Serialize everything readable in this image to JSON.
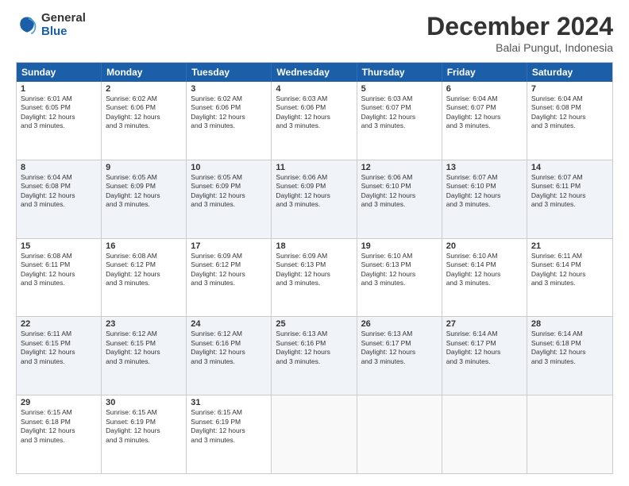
{
  "logo": {
    "line1": "General",
    "line2": "Blue"
  },
  "title": "December 2024",
  "location": "Balai Pungut, Indonesia",
  "days": [
    "Sunday",
    "Monday",
    "Tuesday",
    "Wednesday",
    "Thursday",
    "Friday",
    "Saturday"
  ],
  "rows": [
    [
      {
        "day": "1",
        "text": "Sunrise: 6:01 AM\nSunset: 6:05 PM\nDaylight: 12 hours\nand 3 minutes."
      },
      {
        "day": "2",
        "text": "Sunrise: 6:02 AM\nSunset: 6:06 PM\nDaylight: 12 hours\nand 3 minutes."
      },
      {
        "day": "3",
        "text": "Sunrise: 6:02 AM\nSunset: 6:06 PM\nDaylight: 12 hours\nand 3 minutes."
      },
      {
        "day": "4",
        "text": "Sunrise: 6:03 AM\nSunset: 6:06 PM\nDaylight: 12 hours\nand 3 minutes."
      },
      {
        "day": "5",
        "text": "Sunrise: 6:03 AM\nSunset: 6:07 PM\nDaylight: 12 hours\nand 3 minutes."
      },
      {
        "day": "6",
        "text": "Sunrise: 6:04 AM\nSunset: 6:07 PM\nDaylight: 12 hours\nand 3 minutes."
      },
      {
        "day": "7",
        "text": "Sunrise: 6:04 AM\nSunset: 6:08 PM\nDaylight: 12 hours\nand 3 minutes."
      }
    ],
    [
      {
        "day": "8",
        "text": "Sunrise: 6:04 AM\nSunset: 6:08 PM\nDaylight: 12 hours\nand 3 minutes."
      },
      {
        "day": "9",
        "text": "Sunrise: 6:05 AM\nSunset: 6:09 PM\nDaylight: 12 hours\nand 3 minutes."
      },
      {
        "day": "10",
        "text": "Sunrise: 6:05 AM\nSunset: 6:09 PM\nDaylight: 12 hours\nand 3 minutes."
      },
      {
        "day": "11",
        "text": "Sunrise: 6:06 AM\nSunset: 6:09 PM\nDaylight: 12 hours\nand 3 minutes."
      },
      {
        "day": "12",
        "text": "Sunrise: 6:06 AM\nSunset: 6:10 PM\nDaylight: 12 hours\nand 3 minutes."
      },
      {
        "day": "13",
        "text": "Sunrise: 6:07 AM\nSunset: 6:10 PM\nDaylight: 12 hours\nand 3 minutes."
      },
      {
        "day": "14",
        "text": "Sunrise: 6:07 AM\nSunset: 6:11 PM\nDaylight: 12 hours\nand 3 minutes."
      }
    ],
    [
      {
        "day": "15",
        "text": "Sunrise: 6:08 AM\nSunset: 6:11 PM\nDaylight: 12 hours\nand 3 minutes."
      },
      {
        "day": "16",
        "text": "Sunrise: 6:08 AM\nSunset: 6:12 PM\nDaylight: 12 hours\nand 3 minutes."
      },
      {
        "day": "17",
        "text": "Sunrise: 6:09 AM\nSunset: 6:12 PM\nDaylight: 12 hours\nand 3 minutes."
      },
      {
        "day": "18",
        "text": "Sunrise: 6:09 AM\nSunset: 6:13 PM\nDaylight: 12 hours\nand 3 minutes."
      },
      {
        "day": "19",
        "text": "Sunrise: 6:10 AM\nSunset: 6:13 PM\nDaylight: 12 hours\nand 3 minutes."
      },
      {
        "day": "20",
        "text": "Sunrise: 6:10 AM\nSunset: 6:14 PM\nDaylight: 12 hours\nand 3 minutes."
      },
      {
        "day": "21",
        "text": "Sunrise: 6:11 AM\nSunset: 6:14 PM\nDaylight: 12 hours\nand 3 minutes."
      }
    ],
    [
      {
        "day": "22",
        "text": "Sunrise: 6:11 AM\nSunset: 6:15 PM\nDaylight: 12 hours\nand 3 minutes."
      },
      {
        "day": "23",
        "text": "Sunrise: 6:12 AM\nSunset: 6:15 PM\nDaylight: 12 hours\nand 3 minutes."
      },
      {
        "day": "24",
        "text": "Sunrise: 6:12 AM\nSunset: 6:16 PM\nDaylight: 12 hours\nand 3 minutes."
      },
      {
        "day": "25",
        "text": "Sunrise: 6:13 AM\nSunset: 6:16 PM\nDaylight: 12 hours\nand 3 minutes."
      },
      {
        "day": "26",
        "text": "Sunrise: 6:13 AM\nSunset: 6:17 PM\nDaylight: 12 hours\nand 3 minutes."
      },
      {
        "day": "27",
        "text": "Sunrise: 6:14 AM\nSunset: 6:17 PM\nDaylight: 12 hours\nand 3 minutes."
      },
      {
        "day": "28",
        "text": "Sunrise: 6:14 AM\nSunset: 6:18 PM\nDaylight: 12 hours\nand 3 minutes."
      }
    ],
    [
      {
        "day": "29",
        "text": "Sunrise: 6:15 AM\nSunset: 6:18 PM\nDaylight: 12 hours\nand 3 minutes."
      },
      {
        "day": "30",
        "text": "Sunrise: 6:15 AM\nSunset: 6:19 PM\nDaylight: 12 hours\nand 3 minutes."
      },
      {
        "day": "31",
        "text": "Sunrise: 6:15 AM\nSunset: 6:19 PM\nDaylight: 12 hours\nand 3 minutes."
      },
      {
        "day": "",
        "text": ""
      },
      {
        "day": "",
        "text": ""
      },
      {
        "day": "",
        "text": ""
      },
      {
        "day": "",
        "text": ""
      }
    ]
  ]
}
